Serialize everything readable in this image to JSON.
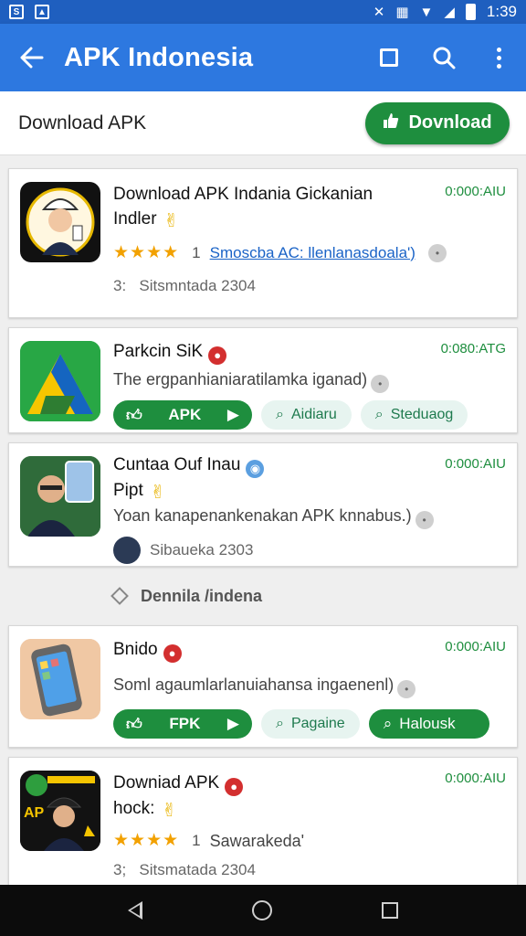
{
  "status_bar": {
    "time": "1:39",
    "left_icons": [
      "sim-icon",
      "image-icon"
    ]
  },
  "app_bar": {
    "title": "APK Indonesia"
  },
  "sub_bar": {
    "title": "Download APK",
    "download_label": "Dovnload"
  },
  "cards": [
    {
      "title_line1": "Download APK Indania Gickanian",
      "title_line2": "Indler",
      "time": "0:000:AIU",
      "stars": "★★★★",
      "rating": "1",
      "link": "Smoscba AC: llenlanasdoala')",
      "meta_prefix": "3:",
      "meta": "Sitsmntada 2304"
    },
    {
      "title": "Parkcin SiK",
      "time": "0:080:ATG",
      "desc": "The ergpanhianiaratilamka iganad)",
      "btn_primary": "APK",
      "btn_secondary_1": "Aidiaru",
      "btn_secondary_2": "Steduaog"
    },
    {
      "title_line1": "Cuntaa Ouf Inau",
      "title_line2": "Pipt",
      "time": "0:000:AIU",
      "desc": "Yoan kanapenankenakan APK knnabus.)",
      "meta": "Sibaueka 2303"
    },
    {
      "title": "Bnido",
      "time": "0:000:AIU",
      "desc": "Soml agaumlarlanuiahansa ingaenenl)",
      "btn_primary": "FPK",
      "btn_secondary_1": "Pagaine",
      "btn_secondary_2": "Halousk"
    },
    {
      "title_line1": "Downiad APK",
      "title_line2": "hock:",
      "time": "0:000:AIU",
      "stars": "★★★★",
      "rating": "1",
      "rating_text": "Sawarakeda'",
      "meta_prefix": "3;",
      "meta": "Sitsmatada 2304",
      "thumb_text": "AP"
    }
  ],
  "section": {
    "label": "Dennila /indena"
  },
  "colors": {
    "primary": "#2d78e0",
    "status": "#1f5fbf",
    "accent": "#1e8e3e"
  }
}
